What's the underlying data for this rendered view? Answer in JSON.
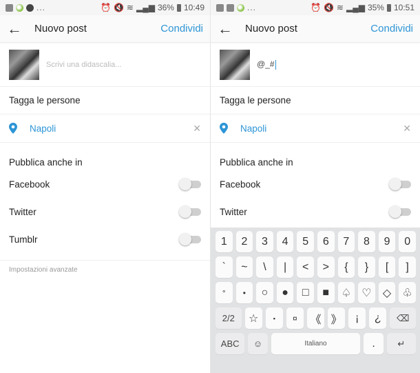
{
  "screens": [
    {
      "status": {
        "percent": "36%",
        "time": "10:49"
      },
      "appbar": {
        "title": "Nuovo post",
        "share": "Condividi"
      },
      "caption": {
        "placeholder": "Scrivi una didascalia...",
        "value": ""
      },
      "tag_people": "Tagga le persone",
      "location": "Napoli",
      "publish_title": "Pubblica anche in",
      "toggles": [
        {
          "label": "Facebook",
          "on": false
        },
        {
          "label": "Twitter",
          "on": false
        },
        {
          "label": "Tumblr",
          "on": false
        }
      ],
      "advanced": "Impostazioni avanzate"
    },
    {
      "status": {
        "percent": "35%",
        "time": "10:51"
      },
      "appbar": {
        "title": "Nuovo post",
        "share": "Condividi"
      },
      "caption": {
        "placeholder": "",
        "value": "@_#"
      },
      "tag_people": "Tagga le persone",
      "location": "Napoli",
      "publish_title": "Pubblica anche in",
      "toggles": [
        {
          "label": "Facebook",
          "on": false
        },
        {
          "label": "Twitter",
          "on": false
        }
      ]
    }
  ],
  "keyboard": {
    "row1": [
      "1",
      "2",
      "3",
      "4",
      "5",
      "6",
      "7",
      "8",
      "9",
      "0"
    ],
    "row2": [
      "`",
      "~",
      "\\",
      "|",
      "<",
      ">",
      "{",
      "}",
      "[",
      "]"
    ],
    "row3": [
      "°",
      "•",
      "○",
      "●",
      "□",
      "■",
      "♤",
      "♡",
      "◇",
      "♧"
    ],
    "row4": {
      "page": "2/2",
      "keys": [
        "☆",
        "▪",
        "¤",
        "《",
        "》",
        "¡",
        "¿"
      ],
      "backspace": "⌫"
    },
    "row5": {
      "abc": "ABC",
      "emoji": "☺",
      "space": "Italiano",
      "period": ".",
      "enter": "↵"
    }
  },
  "colors": {
    "accent": "#2d95d6"
  }
}
